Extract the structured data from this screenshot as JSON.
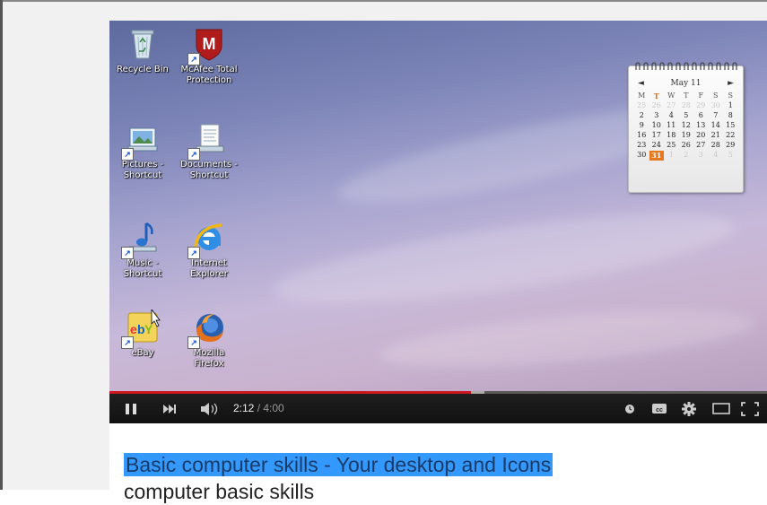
{
  "desktop": {
    "icons": [
      {
        "name": "recycle-bin-icon",
        "label": "Recycle Bin"
      },
      {
        "name": "mcafee-icon",
        "label": "McAfee Total\nProtection"
      },
      {
        "name": "pictures-shortcut-icon",
        "label": "Pictures -\nShortcut"
      },
      {
        "name": "documents-shortcut-icon",
        "label": "Documents -\nShortcut"
      },
      {
        "name": "music-shortcut-icon",
        "label": "Music -\nShortcut"
      },
      {
        "name": "internet-explorer-icon",
        "label": "Internet\nExplorer"
      },
      {
        "name": "ebay-icon",
        "label": "eBay"
      },
      {
        "name": "mozilla-firefox-icon",
        "label": "Mozilla\nFirefox"
      }
    ]
  },
  "calendar": {
    "month_label": "May 11",
    "prev": "◄",
    "next": "►",
    "weekdays": [
      "M",
      "T",
      "W",
      "T",
      "F",
      "S",
      "S"
    ],
    "highlight_weekday_index": 1,
    "rows": [
      [
        "25",
        "26",
        "27",
        "28",
        "29",
        "30",
        "1"
      ],
      [
        "2",
        "3",
        "4",
        "5",
        "6",
        "7",
        "8"
      ],
      [
        "9",
        "10",
        "11",
        "12",
        "13",
        "14",
        "15"
      ],
      [
        "16",
        "17",
        "18",
        "19",
        "20",
        "21",
        "22"
      ],
      [
        "23",
        "24",
        "25",
        "26",
        "27",
        "28",
        "29"
      ],
      [
        "30",
        "31",
        "1",
        "2",
        "3",
        "4",
        "5"
      ]
    ],
    "dim_first_row_count": 6,
    "dim_last_row_from": 2,
    "today": "31"
  },
  "player": {
    "current_time": "2:12",
    "duration": "/ 4:00",
    "progress_fraction": 0.55,
    "buffered_fraction": 0.57,
    "accent_color": "#cc181e"
  },
  "video": {
    "title": "Basic computer skills - Your desktop and Icons",
    "subtitle": "computer basic skills"
  }
}
